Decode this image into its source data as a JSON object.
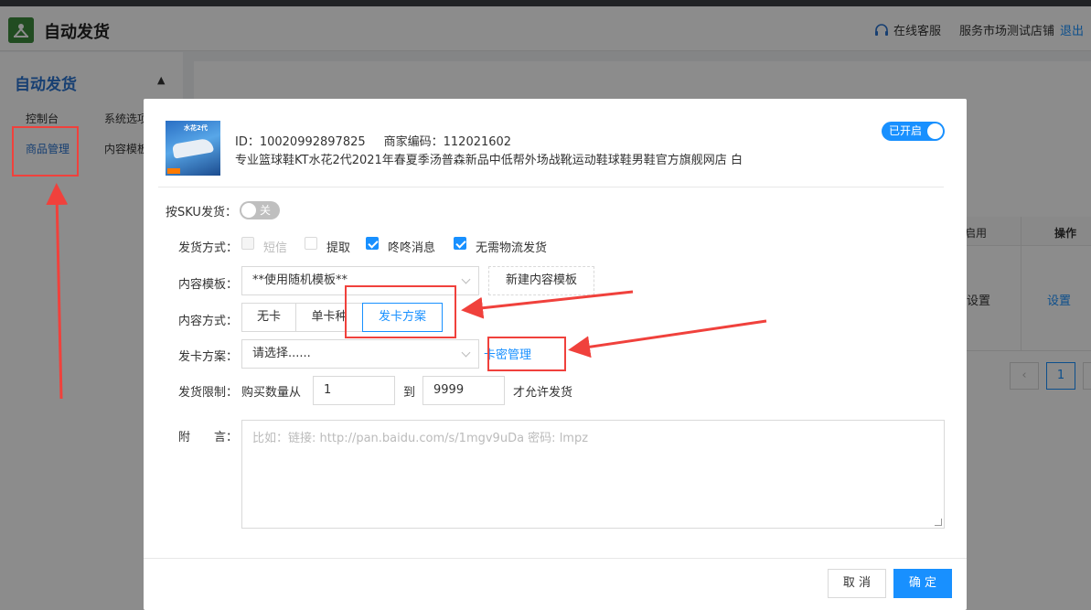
{
  "header": {
    "app_title": "自动发货",
    "logo_icon": "app-logo",
    "service_label": "在线客服",
    "shop_name": "服务市场测试店铺",
    "logout_label": "退出"
  },
  "sidebar": {
    "title": "自动发货",
    "items": [
      {
        "label": "控制台"
      },
      {
        "label": "系统选项"
      },
      {
        "label": "商品管理"
      },
      {
        "label": "内容模板"
      }
    ]
  },
  "background_table": {
    "col_enable": "启用",
    "col_operation": "操作",
    "cell_status": "设置",
    "cell_link": "设置",
    "pager_current": "1"
  },
  "modal": {
    "product": {
      "id_label": "ID：10020992897825",
      "code_label": "商家编码：112021602",
      "name": "专业篮球鞋KT水花2代2021年春夏季汤普森新品中低帮外场战靴运动鞋球鞋男鞋官方旗舰网店 白",
      "image_caption": "水花2代"
    },
    "status_toggle": "已开启",
    "sku_label": "按SKU发货：",
    "sku_toggle": "关",
    "delivery_method": {
      "label": "发货方式：",
      "options": [
        {
          "label": "短信",
          "checked": false,
          "disabled": true
        },
        {
          "label": "提取",
          "checked": false,
          "disabled": false
        },
        {
          "label": "咚咚消息",
          "checked": true,
          "disabled": false
        },
        {
          "label": "无需物流发货",
          "checked": true,
          "disabled": false
        }
      ]
    },
    "content_template": {
      "label": "内容模板：",
      "value": "**使用随机模板**",
      "new_button": "新建内容模板"
    },
    "content_mode": {
      "label": "内容方式：",
      "options": [
        "无卡",
        "单卡种",
        "发卡方案"
      ],
      "selected": "发卡方案"
    },
    "card_plan": {
      "label": "发卡方案：",
      "placeholder": "请选择......",
      "manage_link": "卡密管理"
    },
    "limit": {
      "label": "发货限制：",
      "prefix": "购买数量从",
      "from": "1",
      "to_label": "到",
      "to": "9999",
      "suffix": "才允许发货"
    },
    "note": {
      "label": "附　　言：",
      "placeholder": "比如：链接: http://pan.baidu.com/s/1mgv9uDa 密码: lmpz"
    },
    "cancel_button": "取 消",
    "ok_button": "确 定"
  },
  "colors": {
    "primary": "#1890ff",
    "annotation": "#f0413c"
  }
}
